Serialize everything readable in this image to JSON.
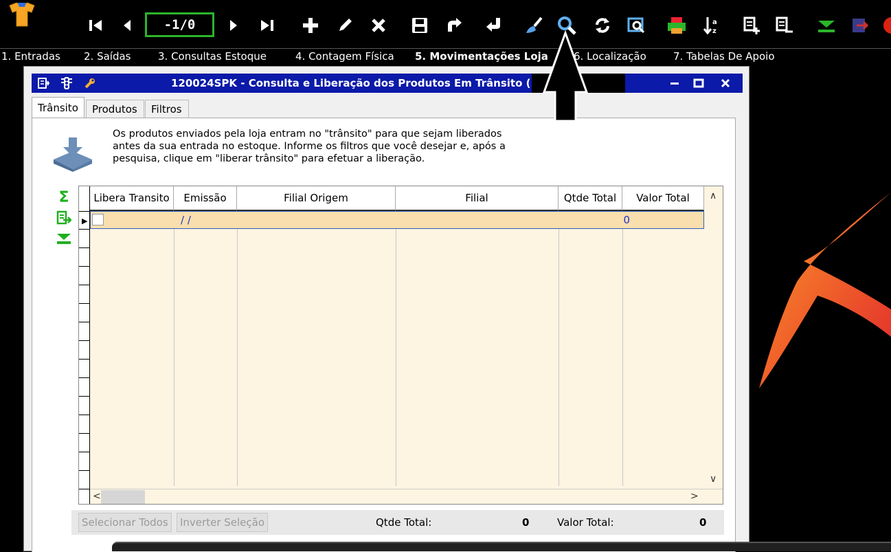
{
  "toolbar": {
    "record_nav": "-1/0",
    "icons": [
      "first-icon",
      "prev-icon",
      "next-icon",
      "last-icon",
      "add-icon",
      "edit-icon",
      "delete-icon",
      "save-icon",
      "redo-icon",
      "undo-icon",
      "brush-icon",
      "search-icon",
      "refresh-icon",
      "preview-icon",
      "print-icon",
      "sort-icon",
      "add-doc-icon",
      "remove-doc-icon",
      "expand-icon",
      "exit-icon"
    ]
  },
  "menu": {
    "items": [
      {
        "label": "1. Entradas"
      },
      {
        "label": "2. Saídas"
      },
      {
        "label": "3. Consultas Estoque"
      },
      {
        "label": "4. Contagem Física"
      },
      {
        "label": "5. Movimentações Loja"
      },
      {
        "label": "6. Localização"
      },
      {
        "label": "7. Tabelas De Apoio"
      }
    ]
  },
  "window": {
    "title": "120024SPK - Consulta e Liberação dos Produtos Em Trânsito (",
    "tabs": [
      {
        "label": "Trânsito"
      },
      {
        "label": "Produtos"
      },
      {
        "label": "Filtros"
      }
    ],
    "info": "Os produtos enviados pela loja entram no \"trânsito\" para que sejam liberados antes da sua entrada no estoque. Informe os filtros que você desejar e, após a pesquisa, clique em \"liberar trânsito\" para efetuar a liberação."
  },
  "grid": {
    "columns": [
      "Libera Transito",
      "Emissão",
      "Filial Origem",
      "Filial",
      "Qtde Total",
      "Valor Total"
    ],
    "rows": [
      {
        "emissao": "/ /",
        "qtde_total": "0",
        "valor_total": ""
      }
    ]
  },
  "footer": {
    "select_all": "Selecionar Todos",
    "invert": "Inverter Seleção",
    "qtde_label": "Qtde Total:",
    "qtde_value": "0",
    "valor_label": "Valor Total:",
    "valor_value": "0"
  },
  "colors": {
    "accent": "#0b1aa8",
    "nav_border": "#2bb52b",
    "row_highlight": "#f9dfad",
    "grid_bg": "#fdf4e1"
  }
}
